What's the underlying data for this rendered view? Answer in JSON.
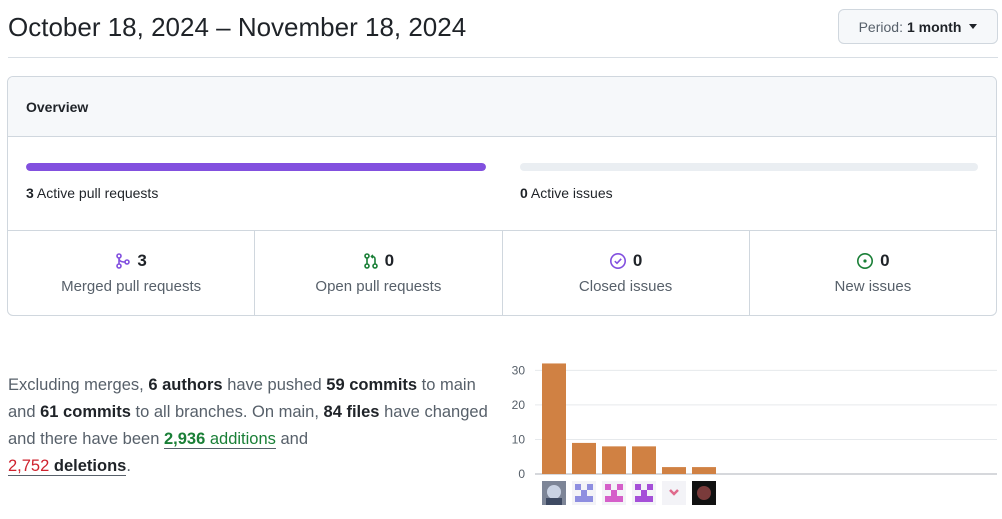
{
  "header": {
    "date_range": "October 18, 2024 – November 18, 2024",
    "period_prefix": "Period:",
    "period_value": "1 month"
  },
  "overview": {
    "title": "Overview",
    "pull_requests_bar": {
      "count": "3",
      "label": "Active pull requests",
      "fill_fraction": 1.0,
      "color": "#8250df"
    },
    "issues_bar": {
      "count": "0",
      "label": "Active issues",
      "fill_fraction": 0.0,
      "color": "#1a7f37"
    },
    "stats": [
      {
        "icon": "git-merge-icon",
        "value": "3",
        "label": "Merged pull requests",
        "color": "#8250df"
      },
      {
        "icon": "git-pull-request-icon",
        "value": "0",
        "label": "Open pull requests",
        "color": "#1a7f37"
      },
      {
        "icon": "issue-closed-icon",
        "value": "0",
        "label": "Closed issues",
        "color": "#8250df"
      },
      {
        "icon": "issue-opened-icon",
        "value": "0",
        "label": "New issues",
        "color": "#1a7f37"
      }
    ]
  },
  "summary": {
    "t1": "Excluding merges, ",
    "authors": "6 authors",
    "t2": " have pushed ",
    "commits_main": "59 commits",
    "t3": " to main and ",
    "commits_all": "61 commits",
    "t4": " to all branches. On main, ",
    "files": "84 files",
    "t5": " have changed and there have been ",
    "additions_num": "2,936",
    "additions_word": "additions",
    "t6": " and",
    "deletions_num": "2,752",
    "deletions_word": "deletions",
    "t7": "."
  },
  "chart_data": {
    "type": "bar",
    "values": [
      32,
      9,
      8,
      8,
      2,
      2
    ],
    "y_ticks": [
      "0",
      "10",
      "20",
      "30"
    ],
    "ylim": [
      0,
      33
    ],
    "bar_color": "#d08143",
    "grid": true,
    "avatars": [
      "avatar-photo-icon",
      "identicon-icon",
      "identicon-icon",
      "identicon-icon",
      "identicon-icon",
      "avatar-dark-icon"
    ]
  }
}
